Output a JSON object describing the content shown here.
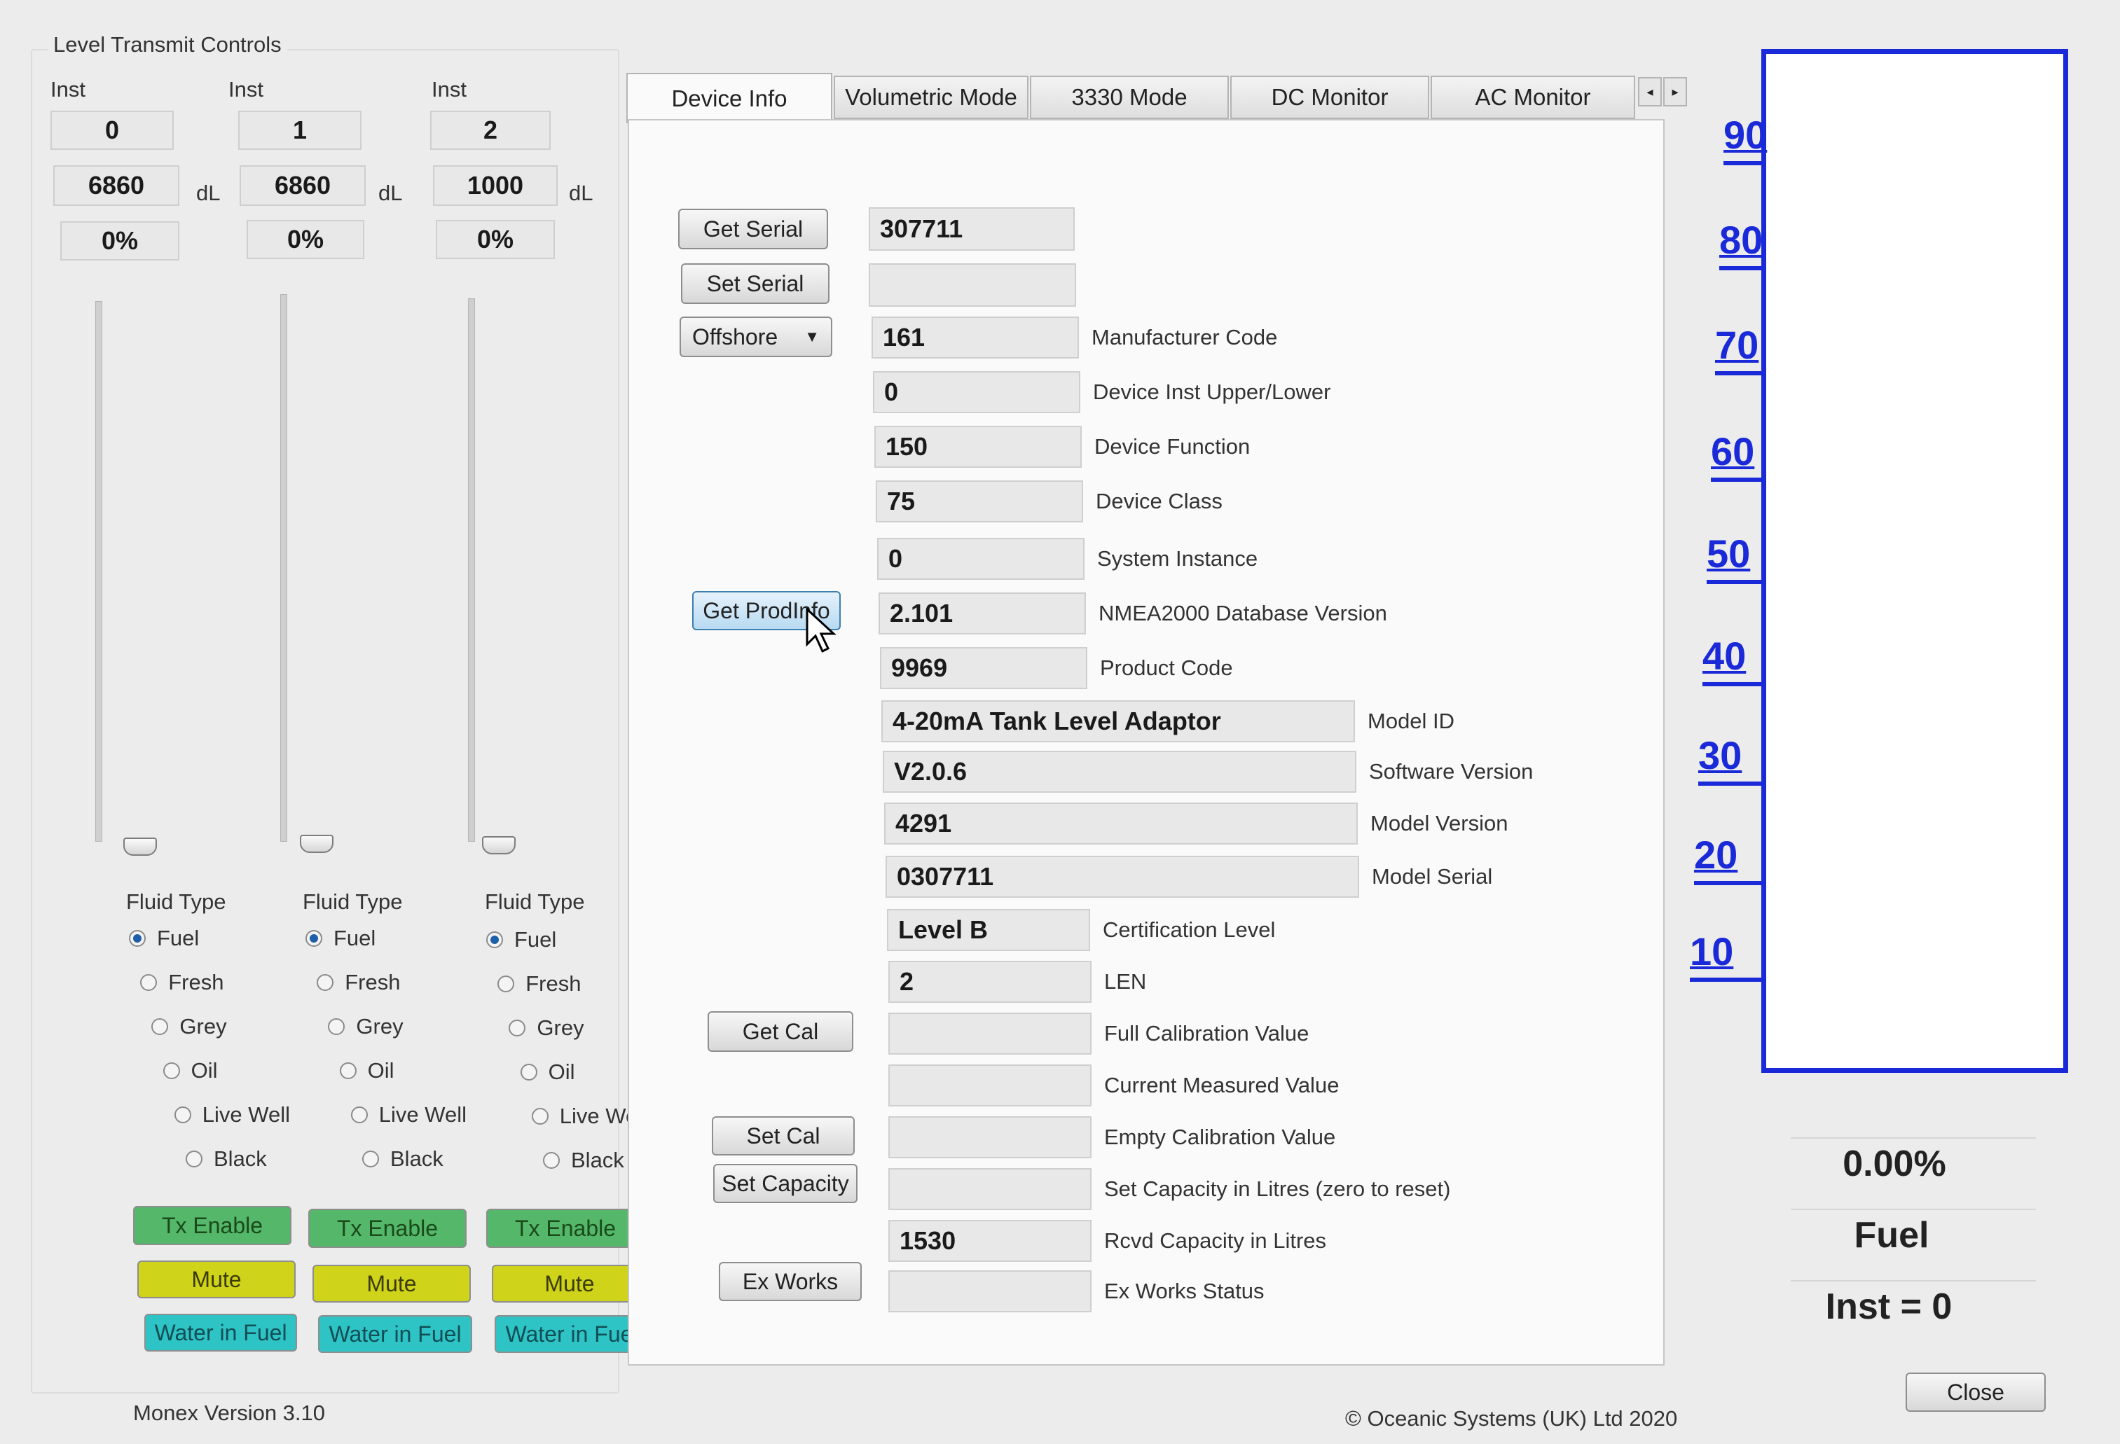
{
  "app": {
    "group_title": "Level Transmit Controls",
    "version_text": "Monex Version 3.10",
    "copyright_text": "© Oceanic Systems (UK) Ltd 2020",
    "close_label": "Close"
  },
  "channels": [
    {
      "inst_label": "Inst",
      "inst_value": "0",
      "level_value": "6860",
      "unit": "dL",
      "percent": "0%",
      "slider_level": 0,
      "fluid_label": "Fluid Type",
      "fluid_options": [
        "Fuel",
        "Fresh",
        "Grey",
        "Oil",
        "Live Well",
        "Black"
      ],
      "selected_fluid": "Fuel",
      "tx_label": "Tx Enable",
      "mute_label": "Mute",
      "water_label": "Water in Fuel"
    },
    {
      "inst_label": "Inst",
      "inst_value": "1",
      "level_value": "6860",
      "unit": "dL",
      "percent": "0%",
      "slider_level": 0,
      "fluid_label": "Fluid Type",
      "fluid_options": [
        "Fuel",
        "Fresh",
        "Grey",
        "Oil",
        "Live Well",
        "Black"
      ],
      "selected_fluid": "Fuel",
      "tx_label": "Tx Enable",
      "mute_label": "Mute",
      "water_label": "Water in Fuel"
    },
    {
      "inst_label": "Inst",
      "inst_value": "2",
      "level_value": "1000",
      "unit": "dL",
      "percent": "0%",
      "slider_level": 0,
      "fluid_label": "Fluid Type",
      "fluid_options": [
        "Fuel",
        "Fresh",
        "Grey",
        "Oil",
        "Live Well",
        "Black"
      ],
      "selected_fluid": "Fuel",
      "tx_label": "Tx Enable",
      "mute_label": "Mute",
      "water_label": "Water in Fuel"
    }
  ],
  "tabs": [
    {
      "label": "Device Info",
      "active": true
    },
    {
      "label": "Volumetric Mode",
      "active": false
    },
    {
      "label": "3330 Mode",
      "active": false
    },
    {
      "label": "DC Monitor",
      "active": false
    },
    {
      "label": "AC Monitor",
      "active": false
    }
  ],
  "device_info": {
    "get_serial_label": "Get Serial",
    "set_serial_label": "Set Serial",
    "mode_dropdown_value": "Offshore",
    "get_prodinfo_label": "Get ProdInfo",
    "get_cal_label": "Get Cal",
    "set_cal_label": "Set Cal",
    "set_capacity_label": "Set Capacity",
    "ex_works_label": "Ex Works",
    "serial_value": "307711",
    "set_serial_value": "",
    "fields": [
      {
        "value": "161",
        "label": "Manufacturer Code"
      },
      {
        "value": "0",
        "label": "Device Inst Upper/Lower"
      },
      {
        "value": "150",
        "label": "Device Function"
      },
      {
        "value": "75",
        "label": "Device Class"
      },
      {
        "value": "0",
        "label": "System Instance"
      },
      {
        "value": "2.101",
        "label": "NMEA2000 Database Version"
      },
      {
        "value": "9969",
        "label": "Product Code"
      },
      {
        "value": "4-20mA Tank Level Adaptor",
        "label": "Model ID"
      },
      {
        "value": "V2.0.6",
        "label": "Software Version"
      },
      {
        "value": "4291",
        "label": "Model Version"
      },
      {
        "value": "0307711",
        "label": "Model Serial"
      },
      {
        "value": "Level B",
        "label": "Certification Level"
      },
      {
        "value": "2",
        "label": "LEN"
      },
      {
        "value": "",
        "label": "Full Calibration Value"
      },
      {
        "value": "",
        "label": "Current Measured Value"
      },
      {
        "value": "",
        "label": "Empty Calibration Value"
      },
      {
        "value": "",
        "label": "Set Capacity in Litres (zero to reset)"
      },
      {
        "value": "1530",
        "label": "Rcvd Capacity in Litres"
      },
      {
        "value": "",
        "label": "Ex Works Status"
      }
    ]
  },
  "gauge": {
    "scale_labels": [
      "90",
      "80",
      "70",
      "60",
      "50",
      "40",
      "30",
      "20",
      "10"
    ],
    "level_percent": 0,
    "percent_text": "0.00%",
    "fluid_text": "Fuel",
    "inst_text": "Inst = 0",
    "color": "#1a2ad8"
  }
}
